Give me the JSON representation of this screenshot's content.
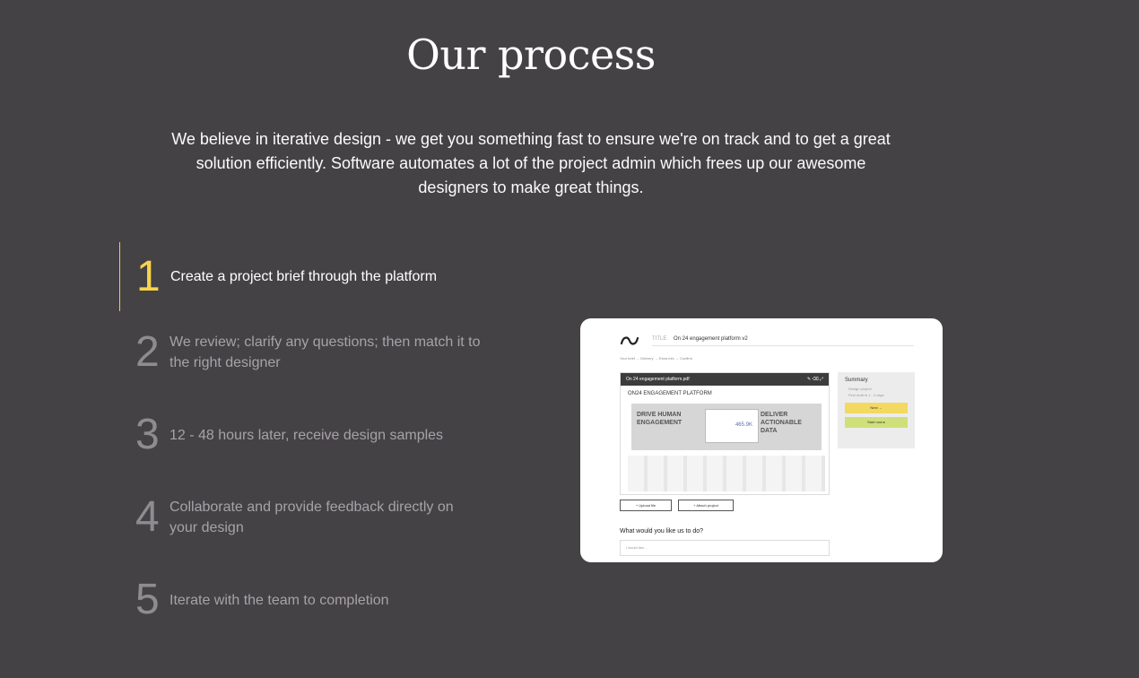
{
  "header": {
    "title": "Our process",
    "intro": "We believe in iterative design - we get you something fast to ensure we're on track and to get a great solution efficiently. Software automates a lot of the project admin which frees up our awesome designers to make great things."
  },
  "steps": [
    {
      "number": "1",
      "text": "Create a project brief through the platform",
      "active": true
    },
    {
      "number": "2",
      "text": "We review; clarify any questions; then match it to the right designer",
      "active": false
    },
    {
      "number": "3",
      "text": "12 - 48 hours later, receive design samples",
      "active": false
    },
    {
      "number": "4",
      "text": "Collaborate and provide feedback directly on your design",
      "active": false
    },
    {
      "number": "5",
      "text": "Iterate with the team to completion",
      "active": false
    }
  ],
  "mockup": {
    "doc_title_label": "TITLE",
    "doc_title": "On 24 engagement platform v2",
    "breadcrumbs": "Your brief  →  Delivery  →  Extra info  →  Confirm",
    "file_name": "On 24 engagement platform.pdf",
    "preview_title": "ON24 ENGAGEMENT PLATFORM",
    "banner_left": "DRIVE HUMAN ENGAGEMENT",
    "banner_right": "DELIVER ACTIONABLE DATA",
    "banner_stat": "465.9K",
    "summary_heading": "Summary",
    "summary_items": [
      "Design project",
      "First draft in 1 - 3 days"
    ],
    "next_label": "Next →",
    "start_label": "Start now ▸",
    "upload_label": "+ Upload file",
    "attach_label": "+ Attach project",
    "question": "What would you like us to do?",
    "input_placeholder": "I would like..."
  },
  "colors": {
    "background": "#454246",
    "accent": "#f7d54a",
    "muted_text": "#a6a3a7",
    "next_button": "#f3d960",
    "start_button": "#cfe07a"
  }
}
